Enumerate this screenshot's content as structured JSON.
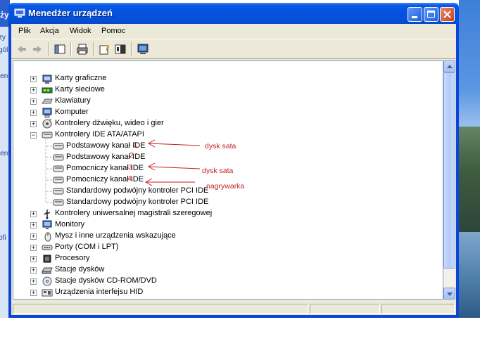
{
  "desktop": {
    "fragments": [
      "żyw",
      "zy",
      "gól",
      "ienc",
      "ierc",
      "ofi"
    ]
  },
  "window": {
    "title": "Menedżer urządzeń"
  },
  "menu": [
    "Plik",
    "Akcja",
    "Widok",
    "Pomoc"
  ],
  "toolbar": [
    {
      "icon": "back-arrow-icon"
    },
    {
      "icon": "forward-arrow-icon"
    },
    {
      "icon": "show-hide-console-tree-icon"
    },
    {
      "icon": "print-icon"
    },
    {
      "icon": "properties-help-icon"
    },
    {
      "icon": "help-icon"
    },
    {
      "icon": "scan-hardware-icon"
    }
  ],
  "tree": [
    {
      "label": "Karty graficzne",
      "icon": "display-adapter-icon",
      "expander": "+"
    },
    {
      "label": "Karty sieciowe",
      "icon": "network-adapter-icon",
      "expander": "+"
    },
    {
      "label": "Klawiatury",
      "icon": "keyboard-icon",
      "expander": "+"
    },
    {
      "label": "Komputer",
      "icon": "computer-icon",
      "expander": "+"
    },
    {
      "label": "Kontrolery dźwięku, wideo i gier",
      "icon": "sound-icon",
      "expander": "+"
    },
    {
      "label": "Kontrolery IDE ATA/ATAPI",
      "icon": "ide-controller-icon",
      "expander": "−"
    },
    {
      "label": "Podstawowy kanał IDE",
      "icon": "ide-channel-icon",
      "expander": ""
    },
    {
      "label": "Podstawowy kanał IDE",
      "icon": "ide-channel-icon",
      "expander": ""
    },
    {
      "label": "Pomocniczy kanał IDE",
      "icon": "ide-channel-icon",
      "expander": ""
    },
    {
      "label": "Pomocniczy kanał IDE",
      "icon": "ide-channel-icon",
      "expander": ""
    },
    {
      "label": "Standardowy podwójny kontroler PCI IDE",
      "icon": "ide-channel-icon",
      "expander": ""
    },
    {
      "label": "Standardowy podwójny kontroler PCI IDE",
      "icon": "ide-channel-icon",
      "expander": ""
    },
    {
      "label": "Kontrolery uniwersalnej magistrali szeregowej",
      "icon": "usb-icon",
      "expander": "+"
    },
    {
      "label": "Monitory",
      "icon": "monitor-icon",
      "expander": "+"
    },
    {
      "label": "Mysz i inne urządzenia wskazujące",
      "icon": "mouse-icon",
      "expander": "+"
    },
    {
      "label": "Porty (COM i LPT)",
      "icon": "port-icon",
      "expander": "+"
    },
    {
      "label": "Procesory",
      "icon": "processor-icon",
      "expander": "+"
    },
    {
      "label": "Stacje dysków",
      "icon": "disk-drive-icon",
      "expander": "+"
    },
    {
      "label": "Stacje dysków CD-ROM/DVD",
      "icon": "cdrom-icon",
      "expander": "+"
    },
    {
      "label": "Urządzenia interfejsu HID",
      "icon": "hid-icon",
      "expander": "+"
    }
  ],
  "annotations": {
    "numbers": [
      "1",
      "2",
      "3",
      "4"
    ],
    "labels": [
      "dysk sata",
      "dysk sata",
      "nagrywarka"
    ]
  },
  "colors": {
    "annotation": "#c81e1e",
    "titlebar": "#0553e0",
    "client": "#ece9d8"
  }
}
